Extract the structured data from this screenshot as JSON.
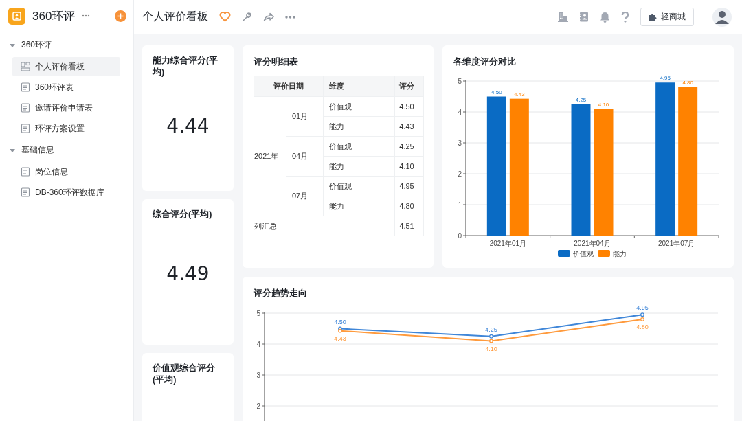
{
  "app": {
    "name": "360环评"
  },
  "sidebar": {
    "groups": [
      {
        "label": "360环评",
        "expanded": true,
        "children": [
          {
            "label": "个人评价看板",
            "kind": "dashboard",
            "selected": true
          },
          {
            "label": "360环评表",
            "kind": "form",
            "selected": false
          },
          {
            "label": "邀请评价申请表",
            "kind": "form",
            "selected": false
          },
          {
            "label": "环评方案设置",
            "kind": "form",
            "selected": false
          }
        ]
      },
      {
        "label": "基础信息",
        "expanded": true,
        "children": [
          {
            "label": "岗位信息",
            "kind": "form",
            "selected": false
          },
          {
            "label": "DB-360环评数据库",
            "kind": "form",
            "selected": false
          }
        ]
      }
    ]
  },
  "page": {
    "title": "个人评价看板",
    "favorited": true
  },
  "toolbar": {
    "shop_button": "轻商城"
  },
  "stat_cards": [
    {
      "title": "能力综合评分(平均)",
      "value": "4.44"
    },
    {
      "title": "综合评分(平均)",
      "value": "4.49"
    },
    {
      "title": "价值观综合评分(平均)"
    }
  ],
  "detail_table": {
    "title": "评分明细表",
    "columns": [
      "评价日期",
      "维度",
      "评分"
    ],
    "groups": [
      {
        "year": "2021年",
        "months": [
          {
            "month": "01月",
            "rows": [
              {
                "dimension": "价值观",
                "score": "4.50"
              },
              {
                "dimension": "能力",
                "score": "4.43"
              }
            ]
          },
          {
            "month": "04月",
            "rows": [
              {
                "dimension": "价值观",
                "score": "4.25"
              },
              {
                "dimension": "能力",
                "score": "4.10"
              }
            ]
          },
          {
            "month": "07月",
            "rows": [
              {
                "dimension": "价值观",
                "score": "4.95"
              },
              {
                "dimension": "能力",
                "score": "4.80"
              }
            ]
          }
        ]
      }
    ],
    "total": {
      "label": "列汇总",
      "score": "4.51"
    }
  },
  "bar_chart": {
    "title": "各维度评分对比",
    "chart_data": {
      "type": "bar",
      "categories": [
        "2021年01月",
        "2021年04月",
        "2021年07月"
      ],
      "series": [
        {
          "name": "价值观",
          "color": "#0a6bc4",
          "values": [
            4.5,
            4.25,
            4.95
          ],
          "value_labels": [
            "4.50",
            "4.25",
            "4.95"
          ]
        },
        {
          "name": "能力",
          "color": "#ff8200",
          "values": [
            4.43,
            4.1,
            4.8
          ],
          "value_labels": [
            "4.43",
            "4.10",
            "4.80"
          ]
        }
      ],
      "ylim": [
        0,
        5
      ],
      "yticks": [
        0,
        1,
        2,
        3,
        4,
        5
      ],
      "grid": true,
      "legend": true
    }
  },
  "trend_chart": {
    "title": "评分趋势走向",
    "chart_data": {
      "type": "line",
      "series": [
        {
          "color": "#3f86d8",
          "values": [
            4.5,
            4.25,
            4.95
          ],
          "value_labels": [
            "4.50",
            "4.25",
            "4.95"
          ],
          "marker": "circle"
        },
        {
          "color": "#ff9a3c",
          "values": [
            4.43,
            4.1,
            4.8
          ],
          "value_labels": [
            "4.43",
            "4.10",
            "4.80"
          ],
          "marker": "circle"
        }
      ],
      "ylim": [
        1.5,
        5
      ],
      "yticks": [
        2,
        3,
        4,
        5
      ],
      "grid": true
    }
  }
}
